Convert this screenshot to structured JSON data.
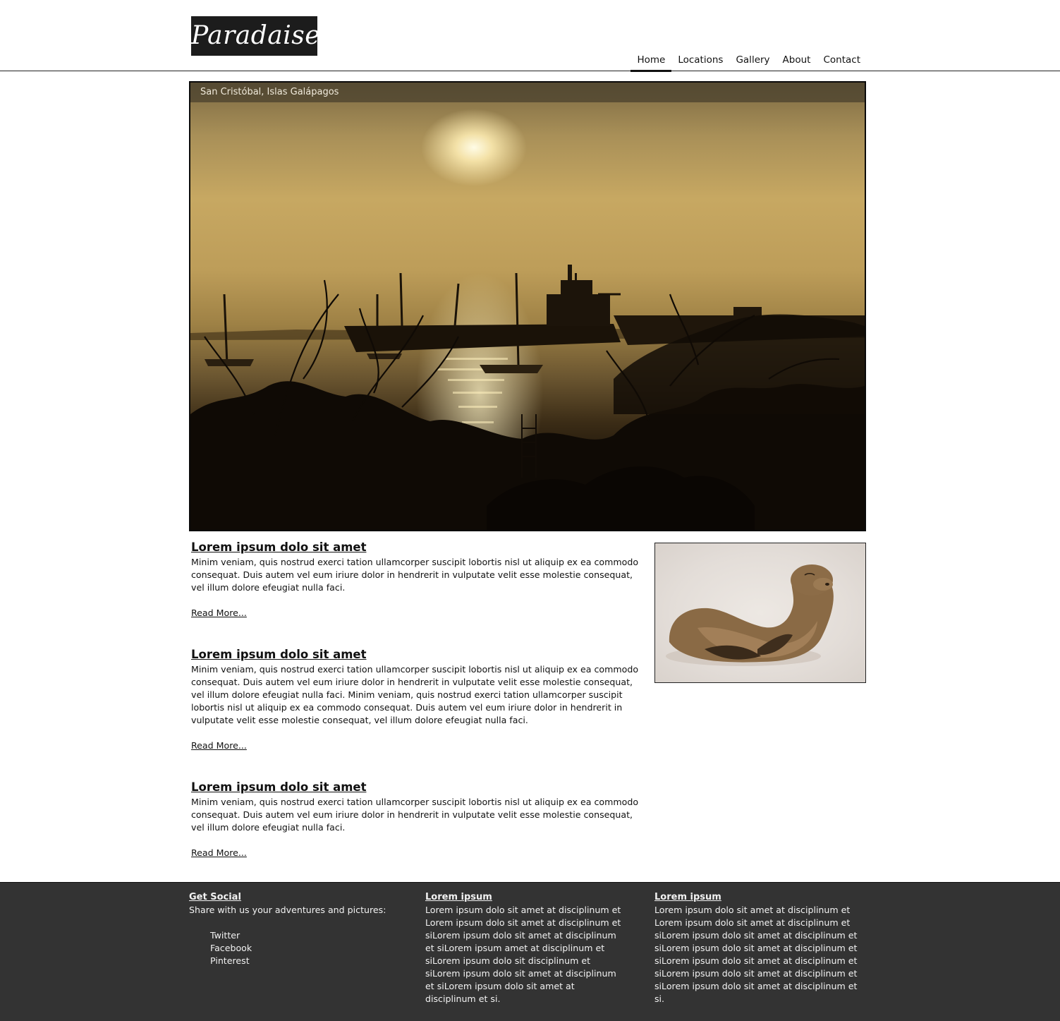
{
  "site": {
    "logo": "Paradaise"
  },
  "nav": {
    "items": [
      "Home",
      "Locations",
      "Gallery",
      "About",
      "Contact"
    ],
    "active": "Home"
  },
  "hero": {
    "caption": "San Cristóbal, Islas Galápagos"
  },
  "articles": [
    {
      "title": "Lorem ipsum dolo sit amet",
      "body": "Minim veniam, quis nostrud exerci tation ullamcorper suscipit lobortis nisl ut aliquip ex ea commodo consequat. Duis autem vel eum iriure dolor in hendrerit in vulputate velit esse molestie consequat, vel illum dolore efeugiat nulla faci.",
      "link": "Read More..."
    },
    {
      "title": "Lorem ipsum dolo sit amet",
      "body": "Minim veniam, quis nostrud exerci tation ullamcorper suscipit lobortis nisl ut aliquip ex ea commodo consequat. Duis autem vel eum iriure dolor in hendrerit in vulputate velit esse molestie consequat, vel illum dolore efeugiat nulla faci. Minim veniam, quis nostrud exerci tation ullamcorper suscipit lobortis nisl ut aliquip ex ea commodo consequat. Duis autem vel eum iriure dolor in hendrerit in vulputate velit esse molestie consequat, vel illum dolore efeugiat nulla faci.",
      "link": "Read More..."
    },
    {
      "title": "Lorem ipsum dolo sit amet",
      "body": "Minim veniam, quis nostrud exerci tation ullamcorper suscipit lobortis nisl ut aliquip ex ea commodo consequat. Duis autem vel eum iriure dolor in hendrerit in vulputate velit esse molestie consequat, vel illum dolore efeugiat nulla faci.",
      "link": "Read More..."
    }
  ],
  "footer": {
    "social": {
      "title": "Get Social",
      "text": "Share with us your adventures and pictures:",
      "links": [
        "Twitter",
        "Facebook",
        "Pinterest"
      ]
    },
    "col2": {
      "title": "Lorem ipsum",
      "text": "Lorem ipsum dolo sit amet at disciplinum et Lorem ipsum dolo sit amet at disciplinum et siLorem ipsum dolo sit amet at disciplinum et siLorem ipsum amet at disciplinum et siLorem ipsum dolo sit disciplinum et siLorem ipsum dolo sit amet at disciplinum et siLorem ipsum dolo sit amet at disciplinum et si."
    },
    "col3": {
      "title": "Lorem ipsum",
      "text": "Lorem ipsum dolo sit amet at disciplinum et Lorem ipsum dolo sit amet at disciplinum et siLorem ipsum dolo sit amet at disciplinum et siLorem ipsum dolo sit amet at disciplinum et siLorem ipsum dolo sit amet at disciplinum et siLorem ipsum dolo sit amet at disciplinum et siLorem ipsum dolo sit amet at disciplinum et si."
    }
  }
}
